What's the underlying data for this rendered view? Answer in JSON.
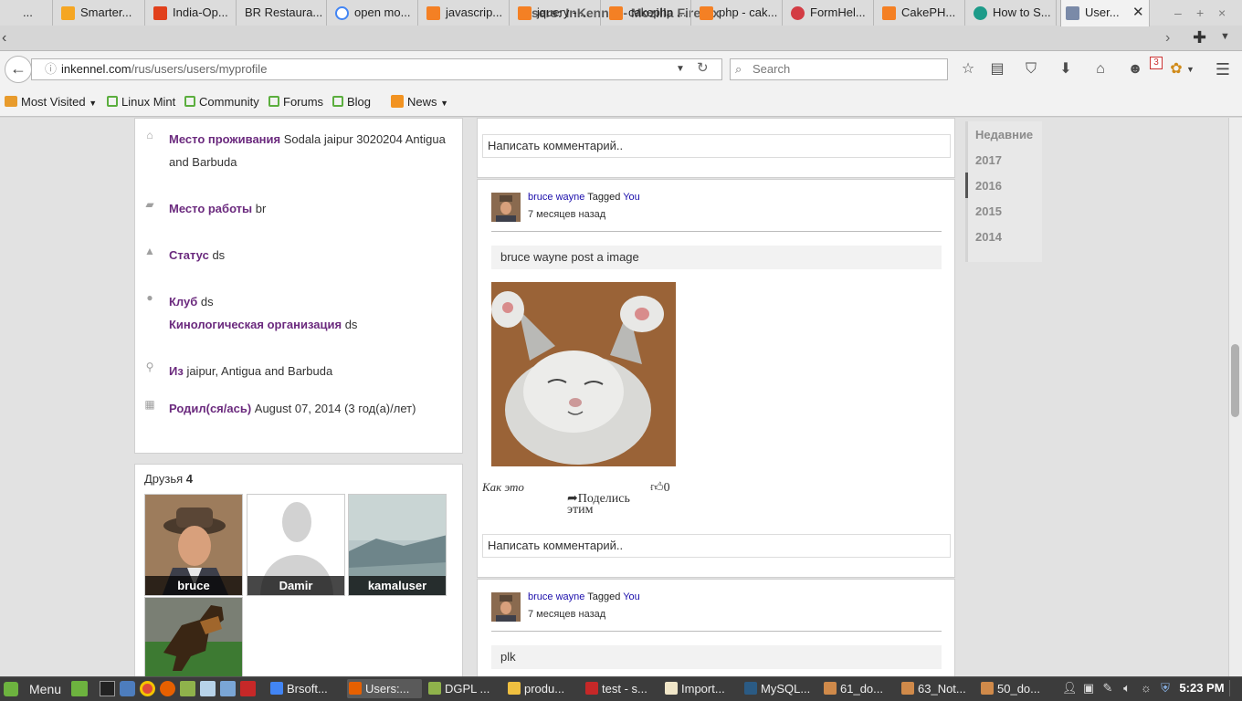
{
  "window": {
    "title": "Users: InKennel - Mozilla Firefox"
  },
  "tabs": [
    {
      "label": "...",
      "color": "#9a9a9a"
    },
    {
      "label": "Smarter...",
      "color": "#f5a623"
    },
    {
      "label": "India-Op...",
      "color": "#e1401c"
    },
    {
      "label": "BR Restaura...",
      "color": "#d6d6d6"
    },
    {
      "label": "open mo...",
      "color": "#4285f4"
    },
    {
      "label": "javascrip...",
      "color": "#f48024"
    },
    {
      "label": "jquery - ...",
      "color": "#f48024"
    },
    {
      "label": "cakephp ...",
      "color": "#f48024"
    },
    {
      "label": "php - cak...",
      "color": "#f48024"
    },
    {
      "label": "FormHel...",
      "color": "#d33c44"
    },
    {
      "label": "CakePH...",
      "color": "#f48024"
    },
    {
      "label": "How to S...",
      "color": "#1d9b89"
    },
    {
      "label": "User...",
      "color": "#7a8aa8"
    }
  ],
  "navbar": {
    "url_host": "inkennel.com",
    "url_path": "/rus/users/users/myprofile",
    "search_placeholder": "Search",
    "badge_count": "3"
  },
  "bookmarks": [
    {
      "label": "Most Visited",
      "icon": "folder-icon"
    },
    {
      "label": "Linux Mint",
      "icon": "mint-icon"
    },
    {
      "label": "Community",
      "icon": "mint-icon"
    },
    {
      "label": "Forums",
      "icon": "mint-icon"
    },
    {
      "label": "Blog",
      "icon": "mint-icon"
    },
    {
      "label": "News",
      "icon": "rss-icon"
    }
  ],
  "profile": {
    "residence_label": "Место проживания",
    "residence_value": "Sodala jaipur 3020204 Antigua and Barbuda",
    "work_label": "Место работы",
    "work_value": "br",
    "status_label": "Статус",
    "status_value": "ds",
    "club_label": "Клуб",
    "club_value": "ds",
    "org_label": "Кинологическая организация",
    "org_value": "ds",
    "from_label": "Из",
    "from_value": "jaipur, Antigua and Barbuda",
    "born_label": "Родил(ся/ась)",
    "born_value": "August 07, 2014 (3 год(а)/лет)"
  },
  "friends": {
    "title": "Друзья",
    "count": "4",
    "items": [
      {
        "name": "bruce"
      },
      {
        "name": "Damir"
      },
      {
        "name": "kamaluser"
      },
      {
        "name": ""
      }
    ]
  },
  "feed": {
    "comment_placeholder": "Написать комментарий..",
    "post1": {
      "author": "bruce wayne",
      "tagged": "Tagged",
      "target": "You",
      "time": "7 месяцев назад",
      "text": "bruce wayne post a image",
      "like_label": "Как это",
      "like_count": "0",
      "share_label": "Поделись этим"
    },
    "post2": {
      "author": "bruce wayne",
      "tagged": "Tagged",
      "target": "You",
      "time": "7 месяцев назад",
      "text": "plk"
    }
  },
  "years": {
    "items": [
      "Недавние",
      "2017",
      "2016",
      "2015",
      "2014"
    ],
    "selected": "2016"
  },
  "taskbar": {
    "menu_label": "Menu",
    "clock": "5:23 PM",
    "windows": [
      {
        "label": "Brsoft...",
        "color": "#4285f4"
      },
      {
        "label": "Users:...",
        "color": "#e66000"
      },
      {
        "label": "DGPL ...",
        "color": "#8fb24b"
      },
      {
        "label": "produ...",
        "color": "#f0c040"
      },
      {
        "label": "test - s...",
        "color": "#c62828"
      },
      {
        "label": "Import...",
        "color": "#f0e6c8"
      },
      {
        "label": "MySQL...",
        "color": "#2b5b84"
      },
      {
        "label": "61_do...",
        "color": "#d08a4a"
      },
      {
        "label": "63_Not...",
        "color": "#d08a4a"
      },
      {
        "label": "50_do...",
        "color": "#d08a4a"
      }
    ]
  }
}
